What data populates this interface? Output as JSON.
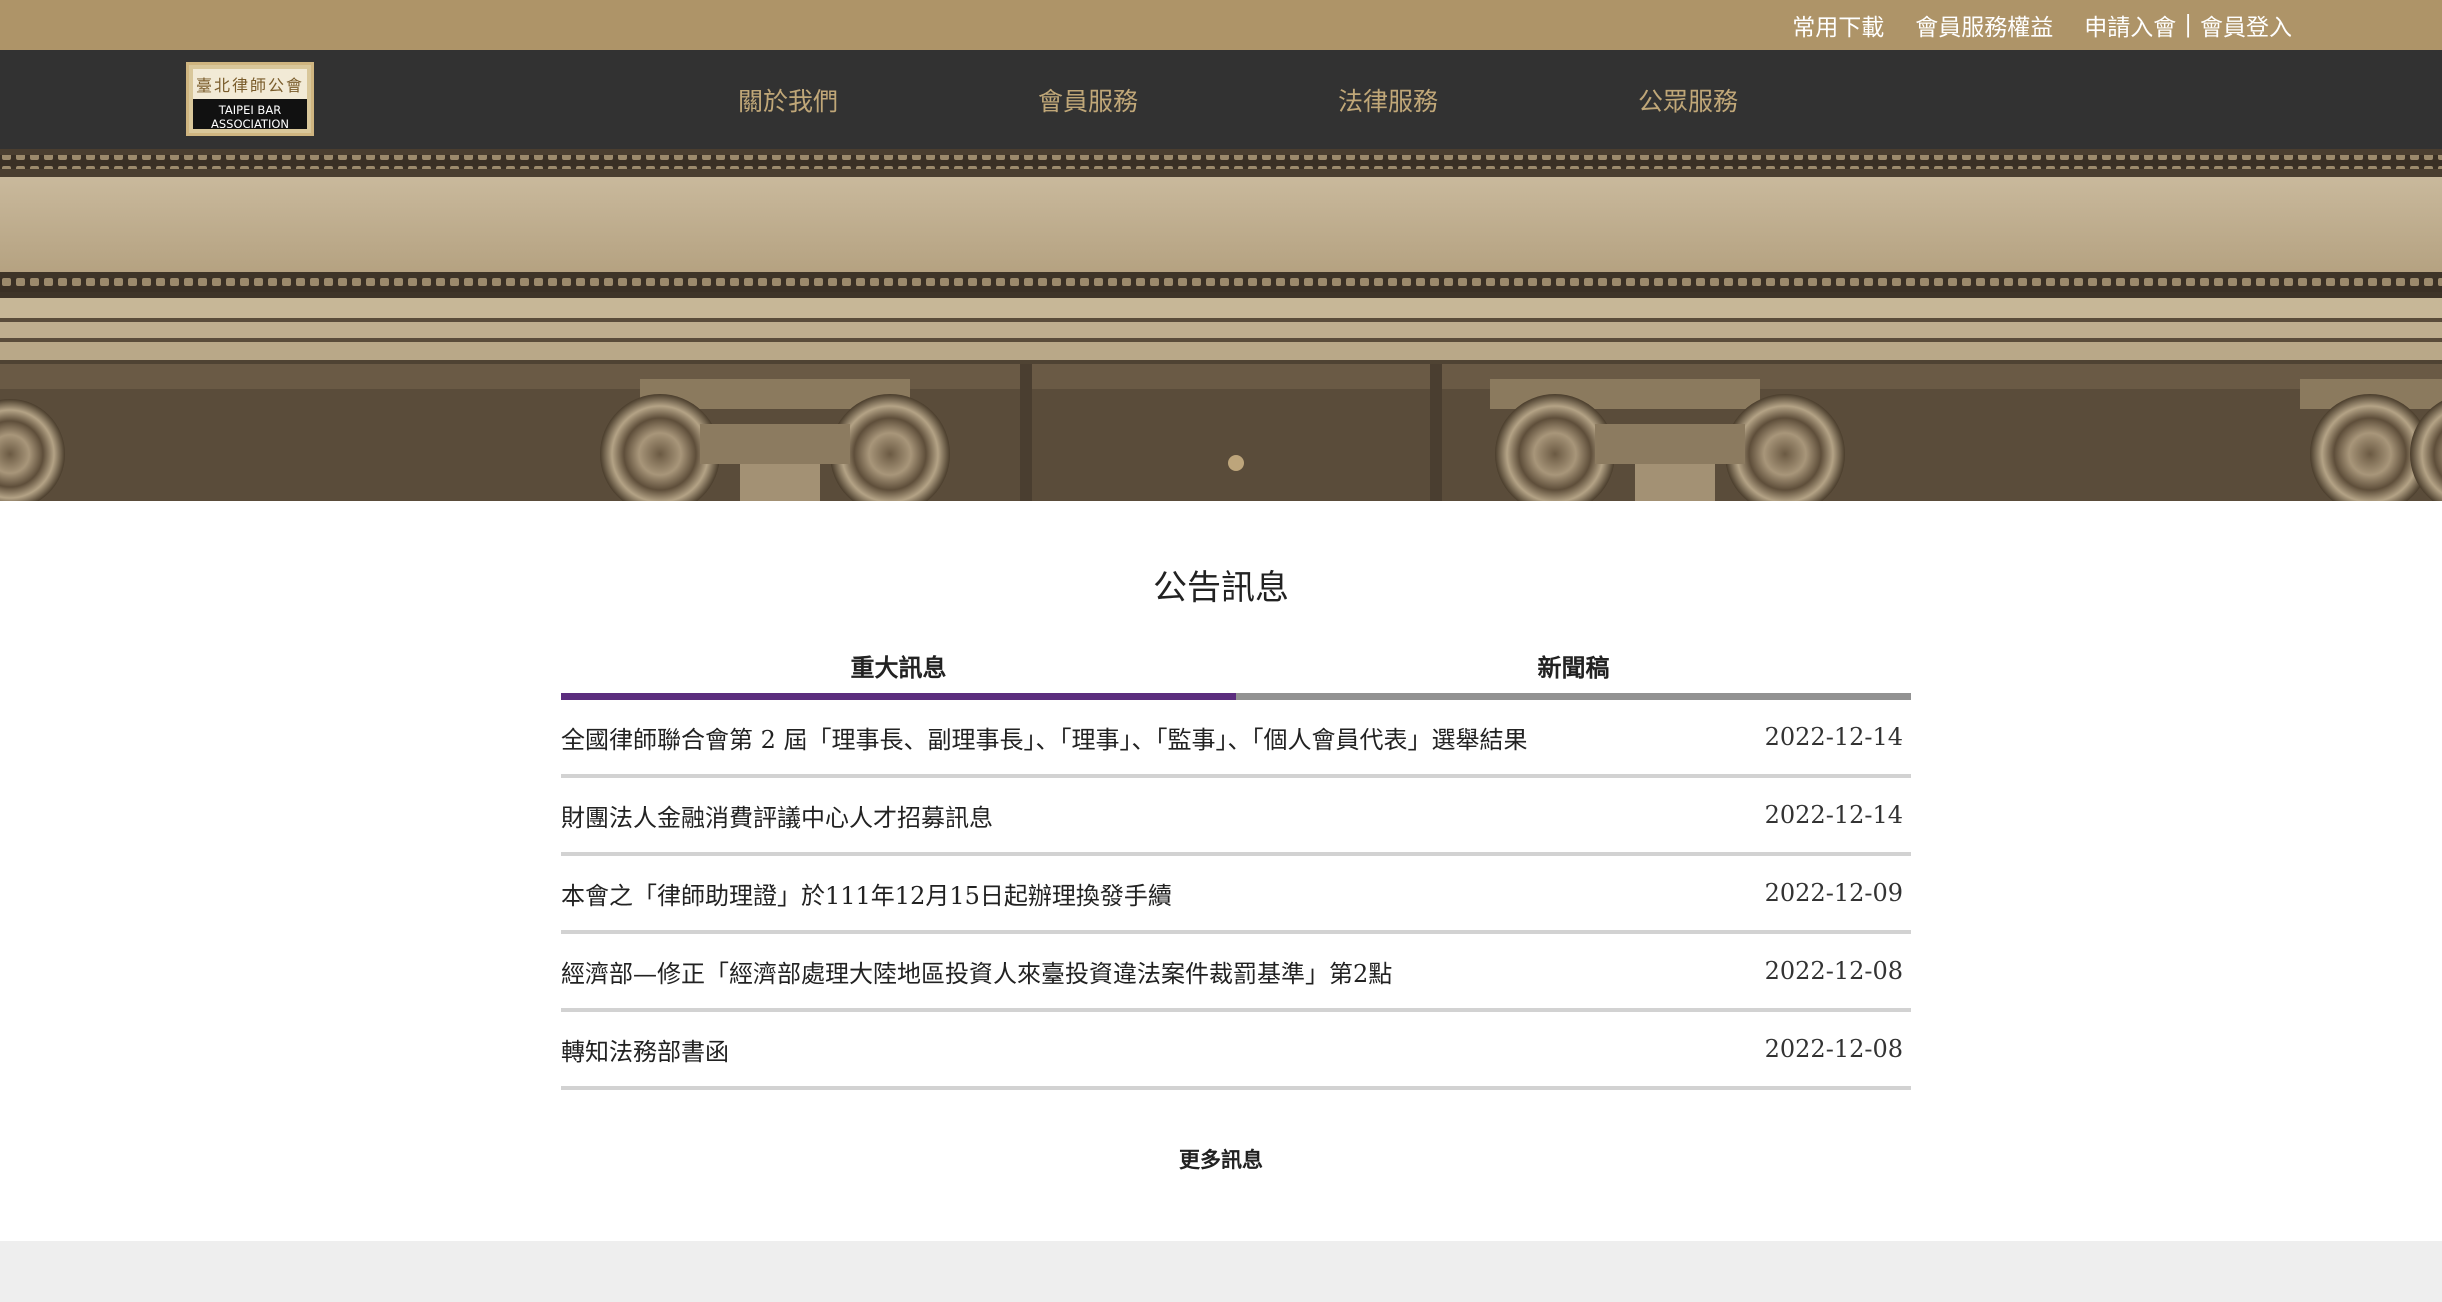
{
  "topbar": {
    "links": [
      "常用下載",
      "會員服務權益"
    ],
    "join": "申請入會",
    "separator": "|",
    "login": "會員登入"
  },
  "logo": {
    "chinese": "臺北律師公會",
    "english_line1": "TAIPEI BAR",
    "english_line2": "ASSOCIATION"
  },
  "nav": {
    "items": [
      "關於我們",
      "會員服務",
      "法律服務",
      "公眾服務"
    ]
  },
  "hero": {
    "carousel_slide": 1,
    "carousel_total": 1
  },
  "announcements": {
    "title": "公告訊息",
    "tabs": [
      "重大訊息",
      "新聞稿"
    ],
    "active_tab": "重大訊息",
    "items": [
      {
        "title": "全國律師聯合會第 2 屆「理事長、副理事長」、「理事」、「監事」、「個人會員代表」選舉結果",
        "date": "2022-12-14"
      },
      {
        "title": "財團法人金融消費評議中心人才招募訊息",
        "date": "2022-12-14"
      },
      {
        "title": "本會之「律師助理證」於111年12月15日起辦理換發手續",
        "date": "2022-12-09"
      },
      {
        "title": "經濟部—修正「經濟部處理大陸地區投資人來臺投資違法案件裁罰基準」第2點",
        "date": "2022-12-08"
      },
      {
        "title": "轉知法務部書函",
        "date": "2022-12-08"
      }
    ],
    "more_label": "更多訊息"
  },
  "colors": {
    "topbar": "#ae9468",
    "navbar": "#323232",
    "nav_text": "#c0a778",
    "active_tab": "#5b2d7e",
    "inactive_tab": "#929292",
    "row_divider": "#d2d2d2",
    "footer_band": "#eeeeee"
  }
}
